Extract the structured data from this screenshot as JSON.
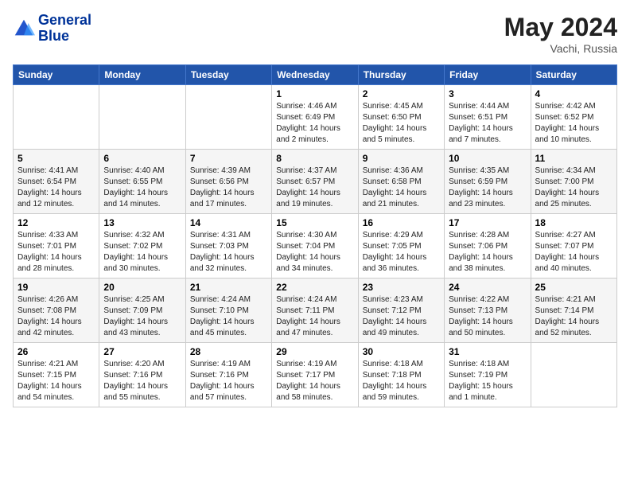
{
  "header": {
    "logo_line1": "General",
    "logo_line2": "Blue",
    "month_year": "May 2024",
    "location": "Vachi, Russia"
  },
  "weekdays": [
    "Sunday",
    "Monday",
    "Tuesday",
    "Wednesday",
    "Thursday",
    "Friday",
    "Saturday"
  ],
  "weeks": [
    [
      {
        "day": "",
        "sunrise": "",
        "sunset": "",
        "daylight": ""
      },
      {
        "day": "",
        "sunrise": "",
        "sunset": "",
        "daylight": ""
      },
      {
        "day": "",
        "sunrise": "",
        "sunset": "",
        "daylight": ""
      },
      {
        "day": "1",
        "sunrise": "Sunrise: 4:46 AM",
        "sunset": "Sunset: 6:49 PM",
        "daylight": "Daylight: 14 hours and 2 minutes."
      },
      {
        "day": "2",
        "sunrise": "Sunrise: 4:45 AM",
        "sunset": "Sunset: 6:50 PM",
        "daylight": "Daylight: 14 hours and 5 minutes."
      },
      {
        "day": "3",
        "sunrise": "Sunrise: 4:44 AM",
        "sunset": "Sunset: 6:51 PM",
        "daylight": "Daylight: 14 hours and 7 minutes."
      },
      {
        "day": "4",
        "sunrise": "Sunrise: 4:42 AM",
        "sunset": "Sunset: 6:52 PM",
        "daylight": "Daylight: 14 hours and 10 minutes."
      }
    ],
    [
      {
        "day": "5",
        "sunrise": "Sunrise: 4:41 AM",
        "sunset": "Sunset: 6:54 PM",
        "daylight": "Daylight: 14 hours and 12 minutes."
      },
      {
        "day": "6",
        "sunrise": "Sunrise: 4:40 AM",
        "sunset": "Sunset: 6:55 PM",
        "daylight": "Daylight: 14 hours and 14 minutes."
      },
      {
        "day": "7",
        "sunrise": "Sunrise: 4:39 AM",
        "sunset": "Sunset: 6:56 PM",
        "daylight": "Daylight: 14 hours and 17 minutes."
      },
      {
        "day": "8",
        "sunrise": "Sunrise: 4:37 AM",
        "sunset": "Sunset: 6:57 PM",
        "daylight": "Daylight: 14 hours and 19 minutes."
      },
      {
        "day": "9",
        "sunrise": "Sunrise: 4:36 AM",
        "sunset": "Sunset: 6:58 PM",
        "daylight": "Daylight: 14 hours and 21 minutes."
      },
      {
        "day": "10",
        "sunrise": "Sunrise: 4:35 AM",
        "sunset": "Sunset: 6:59 PM",
        "daylight": "Daylight: 14 hours and 23 minutes."
      },
      {
        "day": "11",
        "sunrise": "Sunrise: 4:34 AM",
        "sunset": "Sunset: 7:00 PM",
        "daylight": "Daylight: 14 hours and 25 minutes."
      }
    ],
    [
      {
        "day": "12",
        "sunrise": "Sunrise: 4:33 AM",
        "sunset": "Sunset: 7:01 PM",
        "daylight": "Daylight: 14 hours and 28 minutes."
      },
      {
        "day": "13",
        "sunrise": "Sunrise: 4:32 AM",
        "sunset": "Sunset: 7:02 PM",
        "daylight": "Daylight: 14 hours and 30 minutes."
      },
      {
        "day": "14",
        "sunrise": "Sunrise: 4:31 AM",
        "sunset": "Sunset: 7:03 PM",
        "daylight": "Daylight: 14 hours and 32 minutes."
      },
      {
        "day": "15",
        "sunrise": "Sunrise: 4:30 AM",
        "sunset": "Sunset: 7:04 PM",
        "daylight": "Daylight: 14 hours and 34 minutes."
      },
      {
        "day": "16",
        "sunrise": "Sunrise: 4:29 AM",
        "sunset": "Sunset: 7:05 PM",
        "daylight": "Daylight: 14 hours and 36 minutes."
      },
      {
        "day": "17",
        "sunrise": "Sunrise: 4:28 AM",
        "sunset": "Sunset: 7:06 PM",
        "daylight": "Daylight: 14 hours and 38 minutes."
      },
      {
        "day": "18",
        "sunrise": "Sunrise: 4:27 AM",
        "sunset": "Sunset: 7:07 PM",
        "daylight": "Daylight: 14 hours and 40 minutes."
      }
    ],
    [
      {
        "day": "19",
        "sunrise": "Sunrise: 4:26 AM",
        "sunset": "Sunset: 7:08 PM",
        "daylight": "Daylight: 14 hours and 42 minutes."
      },
      {
        "day": "20",
        "sunrise": "Sunrise: 4:25 AM",
        "sunset": "Sunset: 7:09 PM",
        "daylight": "Daylight: 14 hours and 43 minutes."
      },
      {
        "day": "21",
        "sunrise": "Sunrise: 4:24 AM",
        "sunset": "Sunset: 7:10 PM",
        "daylight": "Daylight: 14 hours and 45 minutes."
      },
      {
        "day": "22",
        "sunrise": "Sunrise: 4:24 AM",
        "sunset": "Sunset: 7:11 PM",
        "daylight": "Daylight: 14 hours and 47 minutes."
      },
      {
        "day": "23",
        "sunrise": "Sunrise: 4:23 AM",
        "sunset": "Sunset: 7:12 PM",
        "daylight": "Daylight: 14 hours and 49 minutes."
      },
      {
        "day": "24",
        "sunrise": "Sunrise: 4:22 AM",
        "sunset": "Sunset: 7:13 PM",
        "daylight": "Daylight: 14 hours and 50 minutes."
      },
      {
        "day": "25",
        "sunrise": "Sunrise: 4:21 AM",
        "sunset": "Sunset: 7:14 PM",
        "daylight": "Daylight: 14 hours and 52 minutes."
      }
    ],
    [
      {
        "day": "26",
        "sunrise": "Sunrise: 4:21 AM",
        "sunset": "Sunset: 7:15 PM",
        "daylight": "Daylight: 14 hours and 54 minutes."
      },
      {
        "day": "27",
        "sunrise": "Sunrise: 4:20 AM",
        "sunset": "Sunset: 7:16 PM",
        "daylight": "Daylight: 14 hours and 55 minutes."
      },
      {
        "day": "28",
        "sunrise": "Sunrise: 4:19 AM",
        "sunset": "Sunset: 7:16 PM",
        "daylight": "Daylight: 14 hours and 57 minutes."
      },
      {
        "day": "29",
        "sunrise": "Sunrise: 4:19 AM",
        "sunset": "Sunset: 7:17 PM",
        "daylight": "Daylight: 14 hours and 58 minutes."
      },
      {
        "day": "30",
        "sunrise": "Sunrise: 4:18 AM",
        "sunset": "Sunset: 7:18 PM",
        "daylight": "Daylight: 14 hours and 59 minutes."
      },
      {
        "day": "31",
        "sunrise": "Sunrise: 4:18 AM",
        "sunset": "Sunset: 7:19 PM",
        "daylight": "Daylight: 15 hours and 1 minute."
      },
      {
        "day": "",
        "sunrise": "",
        "sunset": "",
        "daylight": ""
      }
    ]
  ]
}
